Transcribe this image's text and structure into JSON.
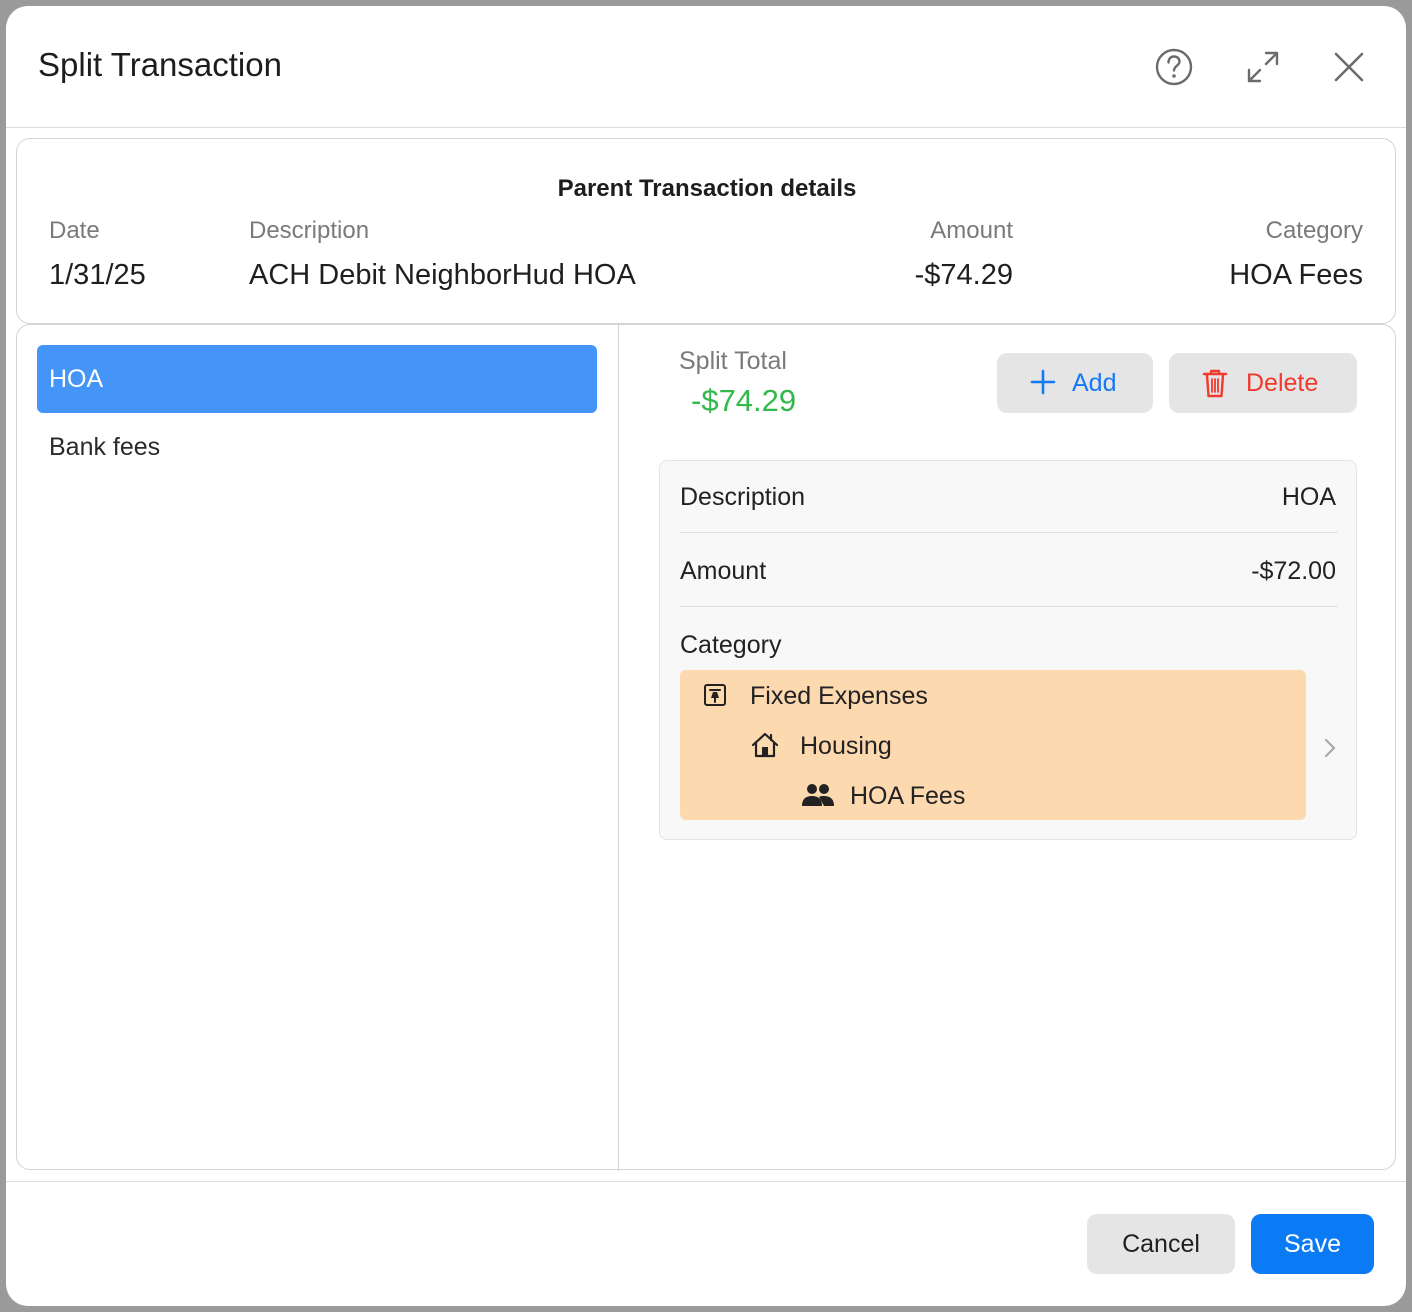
{
  "dialog": {
    "title": "Split Transaction",
    "icons": {
      "help": "help-circle-icon",
      "expand": "expand-icon",
      "close": "close-icon"
    }
  },
  "parent": {
    "heading": "Parent Transaction details",
    "date_label": "Date",
    "date_value": "1/31/25",
    "description_label": "Description",
    "description_value": "ACH Debit NeighborHud HOA",
    "amount_label": "Amount",
    "amount_value": "-$74.29",
    "category_label": "Category",
    "category_value": "HOA Fees"
  },
  "splits": {
    "items": [
      {
        "label": "HOA",
        "selected": true
      },
      {
        "label": "Bank fees",
        "selected": false
      }
    ]
  },
  "detail": {
    "total_label": "Split Total",
    "total_value": "-$74.29",
    "add_label": "Add",
    "delete_label": "Delete",
    "description_label": "Description",
    "description_value": "HOA",
    "amount_label": "Amount",
    "amount_value": "-$72.00",
    "category_label": "Category",
    "category_path": [
      {
        "label": "Fixed Expenses",
        "icon": "pin-icon"
      },
      {
        "label": "Housing",
        "icon": "house-icon"
      },
      {
        "label": "HOA Fees",
        "icon": "people-icon"
      }
    ]
  },
  "footer": {
    "cancel_label": "Cancel",
    "save_label": "Save"
  },
  "colors": {
    "accent": "#0a7af5",
    "selected_row": "#4594f7",
    "positive_total": "#33b84b",
    "delete": "#f03a2e",
    "category_highlight": "#fdd9b0"
  }
}
